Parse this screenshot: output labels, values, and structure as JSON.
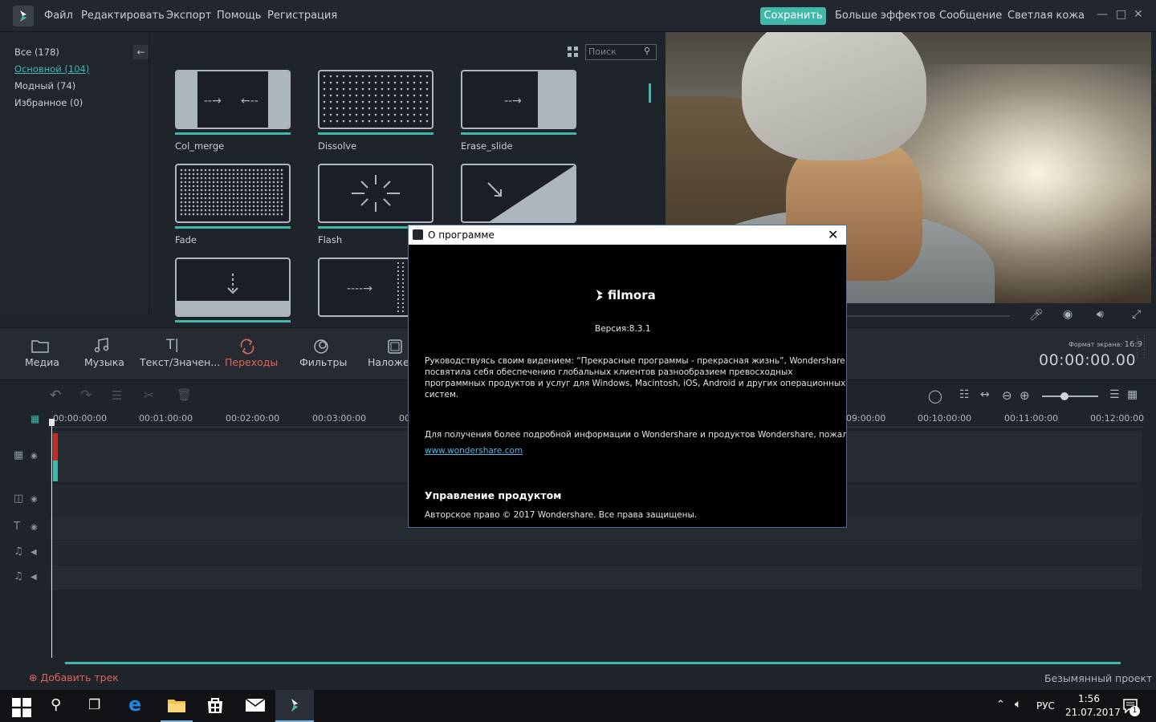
{
  "menu": {
    "items": [
      "Файл",
      "Редактировать",
      "Экспорт",
      "Помощь",
      "Регистрация"
    ],
    "save_label": "Сохранить",
    "right_items": [
      "Больше эффектов",
      "Сообщение",
      "Светлая кожа"
    ]
  },
  "categories": {
    "items": [
      "Все (178)",
      "Основной (104)",
      "Модный (74)",
      "Избранное (0)"
    ],
    "active": 1
  },
  "search": {
    "placeholder": "Поиск"
  },
  "transitions": [
    "Col_merge",
    "Dissolve",
    "Erase_slide",
    "Fade",
    "Flash",
    "",
    "",
    ""
  ],
  "tabs": [
    "Медиа",
    "Музыка",
    "Текст/Значен...",
    "Переходы",
    "Фильтры",
    "Наложен"
  ],
  "active_tab": 3,
  "colors": {
    "accent": "#3fb8a9",
    "active_tab": "#e0635a",
    "link": "#4fb8e8"
  },
  "preview": {
    "aspect_label": "Формат экрана:",
    "aspect_value": "16:9",
    "timecode": "00:00:00.00"
  },
  "ruler": [
    "00:00:00:00",
    "00:01:00:00",
    "00:02:00:00",
    "00:03:00:00",
    "00",
    "09:00:00",
    "00:10:00:00",
    "00:11:00:00",
    "00:12:00:00"
  ],
  "footer": {
    "add_track": "Добавить трек",
    "project_name": "Безымянный проект"
  },
  "dialog": {
    "title": "О программе",
    "logo_text": "filmora",
    "version": "Версия:8.3.1",
    "para1": [
      "Руководствуясь своим видением: “Прекрасные программы - прекрасная жизнь”, Wondershare",
      "посвятила себя обеспечению глобальных клиентов разнообразием превосходных",
      "программных продуктов и услуг для Windows, Macintosh, iOS, Android и других операционных",
      "систем."
    ],
    "para2": "Для получения более подробной информации о Wondershare и продуктов Wondershare, пожалуй",
    "link": "www.wondershare.com",
    "heading": "Управление продуктом",
    "copyright": "Авторское право © 2017 Wondershare. Все права защищены."
  },
  "taskbar": {
    "lang": "РУС",
    "time": "1:56",
    "date": "21.07.2017",
    "notifications": "1"
  }
}
